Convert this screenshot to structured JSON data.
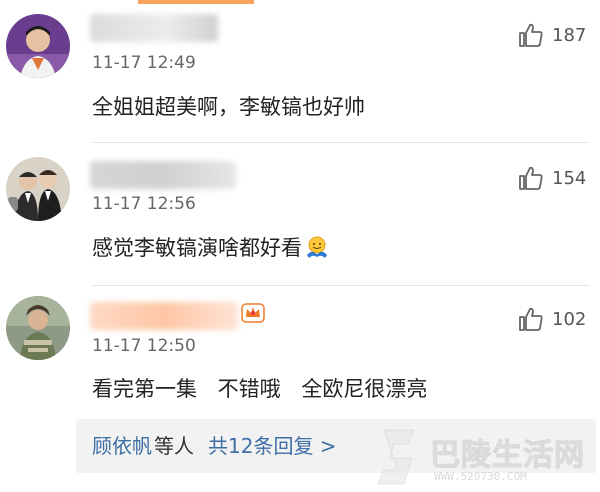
{
  "comments": [
    {
      "time": "11-17 12:49",
      "text": "全姐姐超美啊，李敏镐也好帅",
      "likes": "187"
    },
    {
      "time": "11-17 12:56",
      "text": "感觉李敏镐演啥都好看",
      "likes": "154"
    },
    {
      "time": "11-17 12:50",
      "text": "看完第一集 不错哦 全欧尼很漂亮",
      "likes": "102"
    }
  ],
  "replies": {
    "names": "顾依帆",
    "etc": "等人",
    "total": "共12条回复 >"
  },
  "watermark": {
    "name": "巴陵生活网",
    "url": "WWW.520730.COM"
  },
  "colors": {
    "link": "#3e6ea6",
    "accent": "#f7a35c",
    "reply_bg": "#f2f2f2"
  }
}
